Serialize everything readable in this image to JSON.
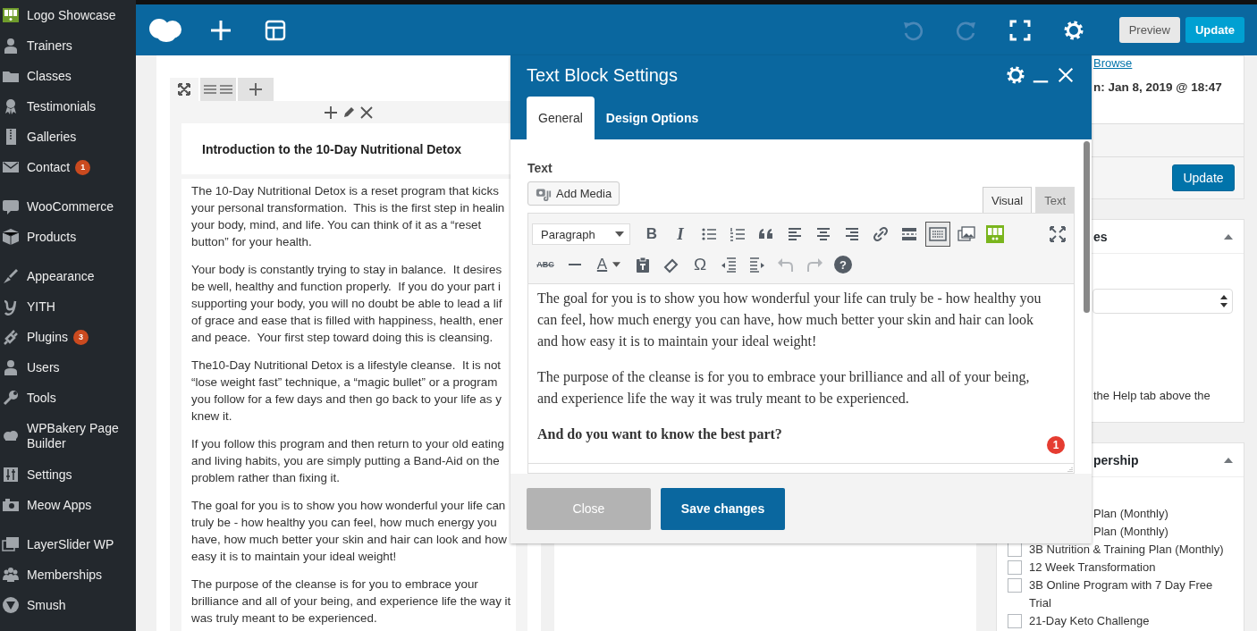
{
  "sidebar": {
    "groups": [
      [
        {
          "label": "Logo Showcase"
        },
        {
          "label": "Trainers"
        },
        {
          "label": "Classes"
        },
        {
          "label": "Testimonials"
        },
        {
          "label": "Galleries"
        },
        {
          "label": "Contact",
          "badge": "1"
        }
      ],
      [
        {
          "label": "WooCommerce"
        },
        {
          "label": "Products"
        }
      ],
      [
        {
          "label": "Appearance"
        },
        {
          "label": "YITH"
        },
        {
          "label": "Plugins",
          "badge": "3"
        },
        {
          "label": "Users"
        },
        {
          "label": "Tools"
        },
        {
          "label": "WPBakery Page Builder"
        },
        {
          "label": "Settings"
        },
        {
          "label": "Meow Apps"
        }
      ],
      [
        {
          "label": "LayerSlider WP"
        },
        {
          "label": "Memberships"
        },
        {
          "label": "Smush"
        }
      ]
    ]
  },
  "topbar": {
    "history": [
      {
        "kind": "undo",
        "disabled": true
      },
      {
        "kind": "redo",
        "disabled": true
      }
    ],
    "buttons": [
      {
        "label": "Preview",
        "kind": "secondary"
      },
      {
        "label": "Update",
        "kind": "primary"
      }
    ]
  },
  "builder": {
    "heading": "Introduction to the 10-Day Nutritional Detox",
    "paragraphs": [
      [
        "The 10-Day Nutritional Detox is a reset program that kicks",
        "your personal transformation.  This is the first step in healin",
        "your body, mind, and life. You can think of it as a “reset",
        "button” for your health."
      ],
      [
        "Your body is constantly trying to stay in balance.  It desires",
        "be well, healthy and function properly.  If you do your part i",
        "supporting your body, you will no doubt be able to lead a lif",
        "of grace and ease that is filled with happiness, health, ener",
        "and peace.  Your first step toward doing this is cleansing."
      ],
      [
        "The10-Day Nutritional Detox is a lifestyle cleanse.  It is not",
        "“lose weight fast” technique, a “magic bullet” or a program",
        "you follow for a few days and then go back to your life as y",
        "knew it."
      ],
      [
        "If you follow this program and then return to your old eating",
        "and living habits, you are simply putting a Band-Aid on the",
        "problem rather than fixing it."
      ],
      [
        "The goal for you is to show you how wonderful your life can",
        "truly be - how healthy you can feel, how much energy you",
        "have, how much better your skin and hair can look and how",
        "easy it is to maintain your ideal weight!"
      ],
      [
        "The purpose of the cleanse is for you to embrace your",
        "brilliance and all of your being, and experience life the way it",
        "was truly meant to be experienced."
      ]
    ]
  },
  "right_column": {
    "browse_link": "Browse",
    "published": "n: Jan 8, 2019 @ 18:47",
    "update_button": "Update",
    "box_title": "es",
    "help_text": "the Help tab above the",
    "membership_title": "pership",
    "partial_rows": [
      "Plan (Monthly)",
      "Plan (Monthly)"
    ],
    "options": [
      {
        "label": "3B Nutrition & Training Plan (Monthly)",
        "checked": false
      },
      {
        "label": "12 Week Transformation",
        "checked": false
      },
      {
        "label": "3B Online Program with 7 Day Free Trial",
        "checked": false
      },
      {
        "label": "21-Day Keto Challenge",
        "checked": false
      }
    ]
  },
  "modal": {
    "title": "Text Block Settings",
    "tabs": [
      {
        "label": "General",
        "selected": true
      },
      {
        "label": "Design Options",
        "selected": false
      }
    ],
    "field_label": "Text",
    "add_media": "Add Media",
    "editor_tabs": [
      {
        "label": "Visual",
        "selected": true
      },
      {
        "label": "Text",
        "selected": false
      }
    ],
    "format_select": "Paragraph",
    "toolbar_rows": [
      [
        {
          "kind": "bold",
          "label": "B",
          "pressed": false,
          "disabled": false
        },
        {
          "kind": "italic",
          "label": "I",
          "pressed": false,
          "disabled": false
        },
        {
          "kind": "bullet-list",
          "pressed": false,
          "disabled": false
        },
        {
          "kind": "numbered-list",
          "pressed": false,
          "disabled": false
        },
        {
          "kind": "blockquote",
          "pressed": false,
          "disabled": false
        },
        {
          "kind": "align-left",
          "pressed": false,
          "disabled": false
        },
        {
          "kind": "align-center",
          "pressed": false,
          "disabled": false
        },
        {
          "kind": "align-right",
          "pressed": false,
          "disabled": false
        },
        {
          "kind": "link",
          "pressed": false,
          "disabled": false
        },
        {
          "kind": "read-more",
          "pressed": false,
          "disabled": false
        },
        {
          "kind": "toolbar-toggle",
          "pressed": true,
          "disabled": false
        },
        {
          "kind": "media",
          "pressed": false,
          "disabled": false
        },
        {
          "kind": "grid-plugin",
          "pressed": false,
          "disabled": false
        },
        {
          "kind": "fullscreen",
          "pressed": false,
          "disabled": false
        }
      ],
      [
        {
          "kind": "strikethrough",
          "label": "ABC",
          "pressed": false,
          "disabled": false
        },
        {
          "kind": "hr",
          "pressed": false,
          "disabled": false
        },
        {
          "kind": "text-color",
          "label": "A",
          "pressed": false,
          "disabled": false
        },
        {
          "kind": "paste-text",
          "pressed": false,
          "disabled": false
        },
        {
          "kind": "clear-formatting",
          "pressed": false,
          "disabled": false
        },
        {
          "kind": "special-char",
          "label": "Ω",
          "pressed": false,
          "disabled": false
        },
        {
          "kind": "outdent",
          "pressed": false,
          "disabled": false
        },
        {
          "kind": "indent",
          "pressed": false,
          "disabled": false
        },
        {
          "kind": "undo",
          "pressed": false,
          "disabled": true
        },
        {
          "kind": "redo",
          "pressed": false,
          "disabled": true
        },
        {
          "kind": "help",
          "label": "?",
          "pressed": false,
          "disabled": false
        }
      ]
    ],
    "content": [
      {
        "kind": "paragraph",
        "text": "The goal for you is to show you how wonderful your life can truly be - how healthy you can feel, how much energy you can have, how much better your skin and hair can look and how easy it is to maintain your ideal weight!"
      },
      {
        "kind": "paragraph",
        "text": "The purpose of the cleanse is for you to embrace your brilliance and all of your being, and experience life the way it was truly meant to be experienced."
      },
      {
        "kind": "bold",
        "text": "And do you want to know the best part?"
      }
    ],
    "notification": "1",
    "buttons": [
      {
        "label": "Close",
        "kind": "secondary"
      },
      {
        "label": "Save changes",
        "kind": "primary"
      }
    ]
  }
}
